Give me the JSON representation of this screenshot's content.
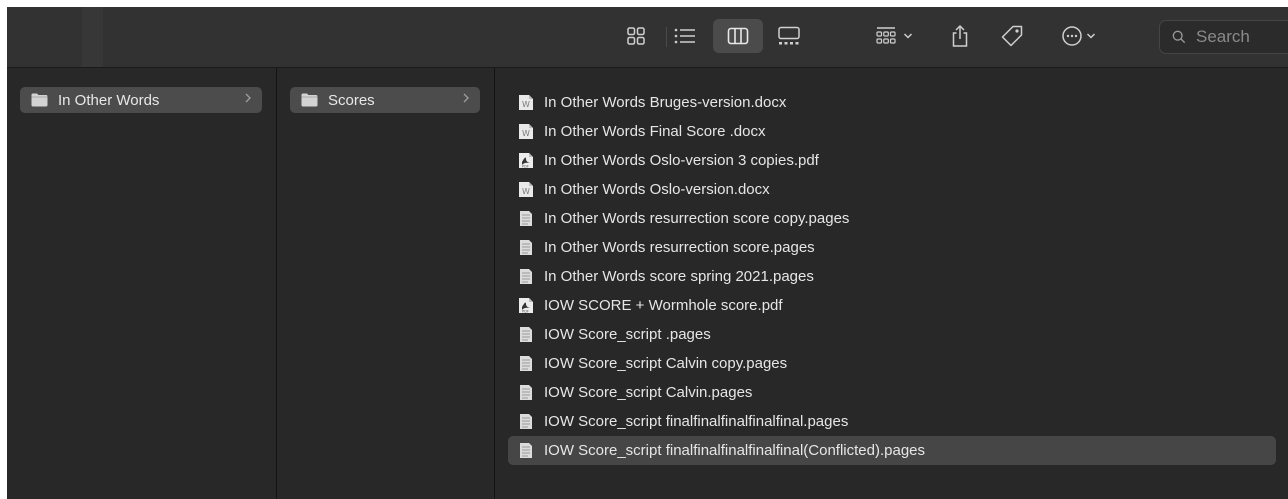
{
  "toolbar": {
    "icons": [
      "icon-view-icon",
      "list-view-icon",
      "column-view-icon",
      "gallery-view-icon",
      "group-icon",
      "share-icon",
      "tag-icon",
      "more-actions-icon"
    ],
    "search_placeholder": "Search"
  },
  "columns": [
    {
      "folder": "In Other Words"
    },
    {
      "folder": "Scores"
    }
  ],
  "files": [
    {
      "name": "In Other Words Bruges-version.docx",
      "icon": "docx-icon"
    },
    {
      "name": "In Other Words Final Score .docx",
      "icon": "docx-icon"
    },
    {
      "name": "In Other Words Oslo-version 3 copies.pdf",
      "icon": "pdf-icon"
    },
    {
      "name": "In Other Words Oslo-version.docx",
      "icon": "docx-icon"
    },
    {
      "name": "In Other Words resurrection score copy.pages",
      "icon": "pages-icon"
    },
    {
      "name": "In Other Words resurrection score.pages",
      "icon": "pages-icon"
    },
    {
      "name": "In Other Words score spring 2021.pages",
      "icon": "pages-icon"
    },
    {
      "name": "IOW SCORE + Wormhole score.pdf",
      "icon": "pdf-icon"
    },
    {
      "name": "IOW Score_script .pages",
      "icon": "pages-icon"
    },
    {
      "name": "IOW Score_script Calvin copy.pages",
      "icon": "pages-icon"
    },
    {
      "name": "IOW Score_script Calvin.pages",
      "icon": "pages-icon"
    },
    {
      "name": "IOW Score_script finalfinalfinalfinalfinal.pages",
      "icon": "pages-icon"
    },
    {
      "name": "IOW Score_script finalfinalfinalfinalfinal(Conflicted).pages",
      "icon": "pages-icon",
      "selected": true
    }
  ]
}
